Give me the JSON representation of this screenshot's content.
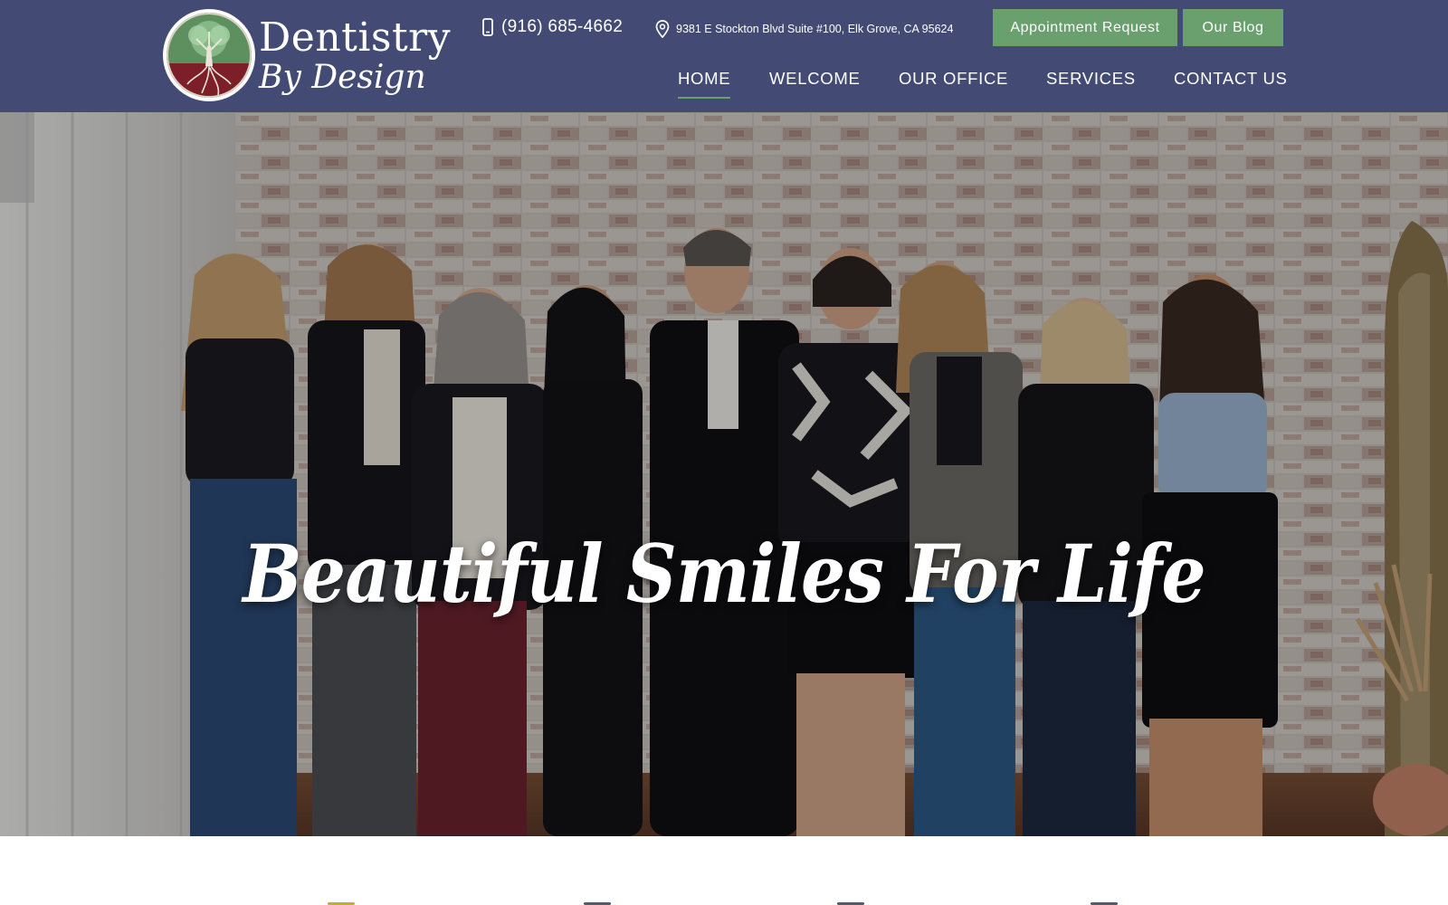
{
  "brand": {
    "name_line1": "Dentistry",
    "name_line2": "By Design",
    "logo_icon": "tree-icon"
  },
  "contact": {
    "phone": "(916) 685-4662",
    "phone_icon": "mobile-phone-icon",
    "address": "9381 E Stockton Blvd Suite #100, Elk Grove, CA 95624",
    "address_icon": "map-pin-icon"
  },
  "buttons": {
    "appointment": "Appointment Request",
    "blog": "Our Blog"
  },
  "nav": {
    "items": [
      {
        "label": "HOME",
        "active": true
      },
      {
        "label": "WELCOME",
        "active": false
      },
      {
        "label": "OUR OFFICE",
        "active": false
      },
      {
        "label": "SERVICES",
        "active": false
      },
      {
        "label": "CONTACT US",
        "active": false
      }
    ]
  },
  "hero": {
    "headline": "Beautiful Smiles For Life",
    "image": "team-photo"
  },
  "colors": {
    "header_bg": "#434b75",
    "accent_green": "#6a9f6e",
    "text_light": "#ffffff",
    "logo_maroon": "#7c1f28",
    "logo_green": "#5d8f5f"
  }
}
